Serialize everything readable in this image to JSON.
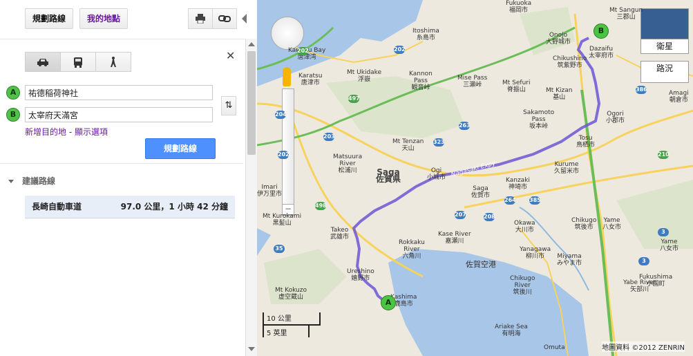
{
  "toolbar": {
    "directions_tab": "規劃路線",
    "my_places_tab": "我的地點",
    "print_icon": "printer-icon",
    "link_icon": "link-icon"
  },
  "modes": [
    {
      "name": "car-icon",
      "selected": true
    },
    {
      "name": "bus-icon",
      "selected": false
    },
    {
      "name": "walk-icon",
      "selected": false
    }
  ],
  "route": {
    "origin_label": "A",
    "origin": "祐德稲荷神社",
    "destination_label": "B",
    "destination": "太宰府天滿宮",
    "add_destination": "新增目的地",
    "separator": " - ",
    "show_options": "顯示選項",
    "submit": "規劃路線"
  },
  "suggested": {
    "heading": "建議路線",
    "routes": [
      {
        "name": "長崎自動車道",
        "summary": "97.0 公里，1 小時 42 分鐘"
      }
    ]
  },
  "map": {
    "map_type_satellite": "衛星",
    "map_type_road": "路況",
    "scale_km": "10 公里",
    "scale_mi": "5 英里",
    "attribution": "地圖資料 ©2012 ZENRIN",
    "marker_a": "A",
    "marker_b": "B",
    "labels": [
      {
        "text": "Itoshima\n糸島市"
      },
      {
        "text": "Karatsu Bay\n唐津湾"
      },
      {
        "text": "Karatsu\n唐津市"
      },
      {
        "text": "Mt Ukidake\n浮嶽"
      },
      {
        "text": "Kannon\nPass\n観音峠"
      },
      {
        "text": "Mise Pass\n三瀬峠"
      },
      {
        "text": "Mt Sefuri\n脊振山"
      },
      {
        "text": "Mt Kizan\n基山"
      },
      {
        "text": "Dazaifu\n太宰府市"
      },
      {
        "text": "Chikushino\n筑紫野市"
      },
      {
        "text": "Onojo\n大野城市"
      },
      {
        "text": "Fukuoka\n福岡市"
      },
      {
        "text": "Mt Sangun\n三郡山"
      },
      {
        "text": "Sakamoto\nPass\n坂本峠"
      },
      {
        "text": "Ogori\n小郡市"
      },
      {
        "text": "Tosu\n鳥栖市"
      },
      {
        "text": "Mt Tenzan\n天山"
      },
      {
        "text": "Matsuura\nRiver\n松浦川"
      },
      {
        "text": "Saga\n佐賀県"
      },
      {
        "text": "Ogi\n小城市"
      },
      {
        "text": "Kurume\n久留米市"
      },
      {
        "text": "Kanzaki\n神埼市"
      },
      {
        "text": "Saga\n佐賀市"
      },
      {
        "text": "Imari\n伊万里市"
      },
      {
        "text": "Mt Kurokami\n黒髪山"
      },
      {
        "text": "Takeo\n武雄市"
      },
      {
        "text": "Rokkaku\nRiver\n六角川"
      },
      {
        "text": "Kase River\n嘉瀬川"
      },
      {
        "text": "佐賀空港"
      },
      {
        "text": "Okawa\n大川市"
      },
      {
        "text": "Chikugo\n筑後市"
      },
      {
        "text": "Yame\n八女市"
      },
      {
        "text": "Yanagawa\n柳川市"
      },
      {
        "text": "Miyama\nみやま市"
      },
      {
        "text": "Ureshino\n嬉野市"
      },
      {
        "text": "Kashima\n鹿島市"
      },
      {
        "text": "Mt Kokuzo\n虚空蔵山"
      },
      {
        "text": "Chikugo\nRiver\n筑後川"
      },
      {
        "text": "Yabe River\n矢部川"
      },
      {
        "text": "Ariake Sea\n有明海"
      },
      {
        "text": "Omuta"
      },
      {
        "text": "Amagi\n朝倉市"
      },
      {
        "text": "Fukushima\n小国町"
      },
      {
        "text": "Yame\n八女市"
      }
    ],
    "road_label": "Nagasaki Expy"
  }
}
